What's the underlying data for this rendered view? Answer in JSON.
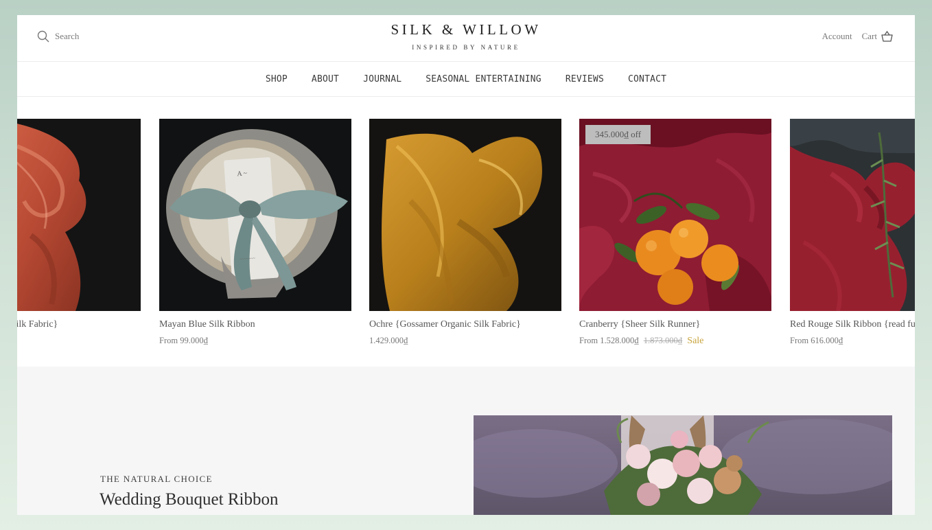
{
  "header": {
    "search_label": "Search",
    "logo_title": "SILK & WILLOW",
    "logo_tagline": "INSPIRED BY NATURE",
    "account_label": "Account",
    "cart_label": "Cart"
  },
  "nav": {
    "items": [
      "SHOP",
      "ABOUT",
      "JOURNAL",
      "SEASONAL ENTERTAINING",
      "REVIEWS",
      "CONTACT"
    ]
  },
  "products": [
    {
      "title": "ssamer Organic Silk Fabric}",
      "price": "",
      "image": "rust-silk-fabric"
    },
    {
      "title": "Mayan Blue Silk Ribbon",
      "price": "From 99.000₫",
      "image": "blue-ribbon-place-setting"
    },
    {
      "title": "Ochre {Gossamer Organic Silk Fabric}",
      "price": "1.429.000₫",
      "image": "ochre-silk-fabric"
    },
    {
      "title": "Cranberry {Sheer Silk Runner}",
      "price": "From 1.528.000₫",
      "compare_price": "1.873.000₫",
      "sale_label": "Sale",
      "badge": "345.000₫ off",
      "image": "cranberry-runner-oranges"
    },
    {
      "title": "Red Rouge Silk Ribbon {read full",
      "price": "From 616.000₫",
      "image": "red-rouge-ribbon"
    }
  ],
  "feature": {
    "eyebrow": "THE NATURAL CHOICE",
    "title": "Wedding Bouquet Ribbon",
    "image": "bride-holding-bouquet"
  },
  "colors": {
    "page_background": "#c8dccf",
    "sale_accent": "#c8a43c",
    "feature_background": "#f6f6f7"
  }
}
